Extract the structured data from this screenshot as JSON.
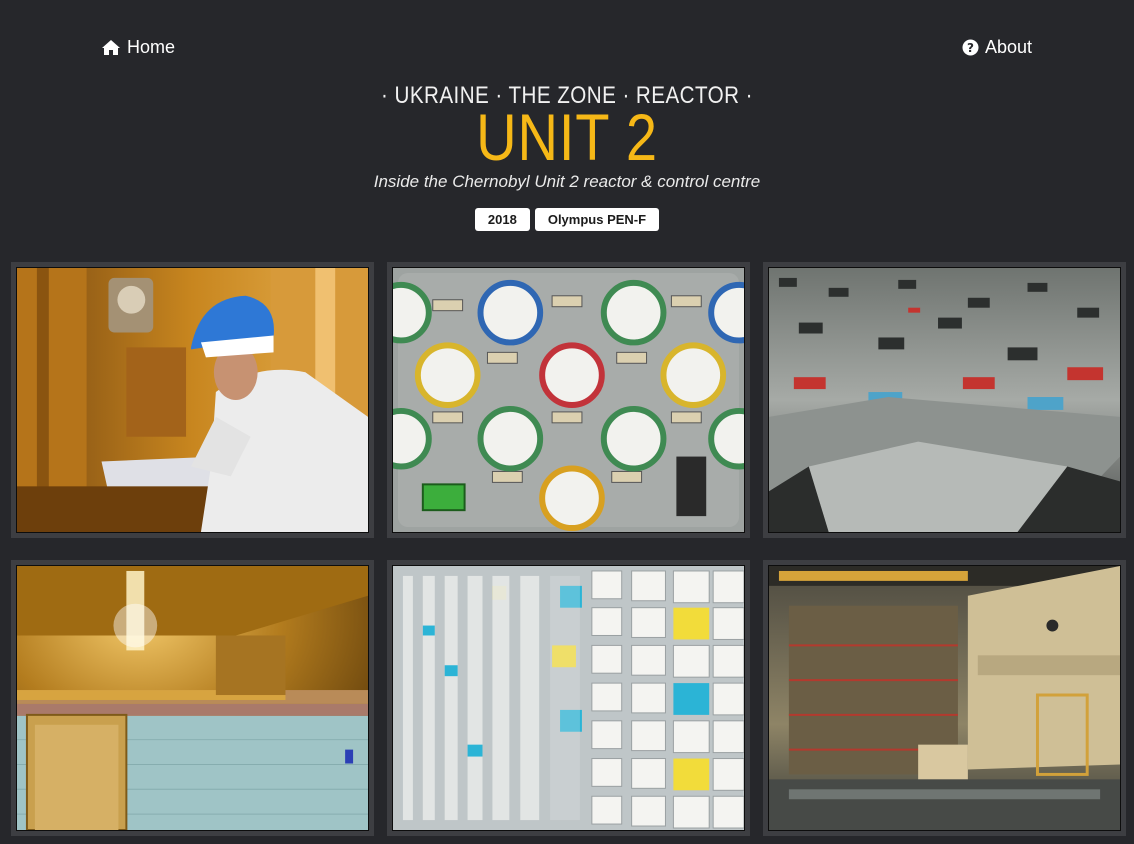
{
  "nav": {
    "home_label": "Home",
    "home_icon": "home-icon",
    "about_label": "About",
    "about_icon": "question-circle-icon"
  },
  "header": {
    "kicker": "· UKRAINE · THE ZONE · REACTOR ·",
    "title": "UNIT 2",
    "subtitle": "Inside the Chernobyl Unit 2 reactor & control centre",
    "badges": [
      "2018",
      "Olympus PEN-F"
    ]
  },
  "colors": {
    "background": "#26272b",
    "title_accent": "#f6b817",
    "tile_frame": "#3d3e42"
  },
  "gallery": {
    "photos": [
      {
        "name": "photo-worker-blue-helmet"
      },
      {
        "name": "photo-control-panel-gauges"
      },
      {
        "name": "photo-reactor-floor-plates"
      },
      {
        "name": "photo-yellow-corridor-door"
      },
      {
        "name": "photo-channel-number-grid"
      },
      {
        "name": "photo-turbine-hall"
      }
    ]
  }
}
